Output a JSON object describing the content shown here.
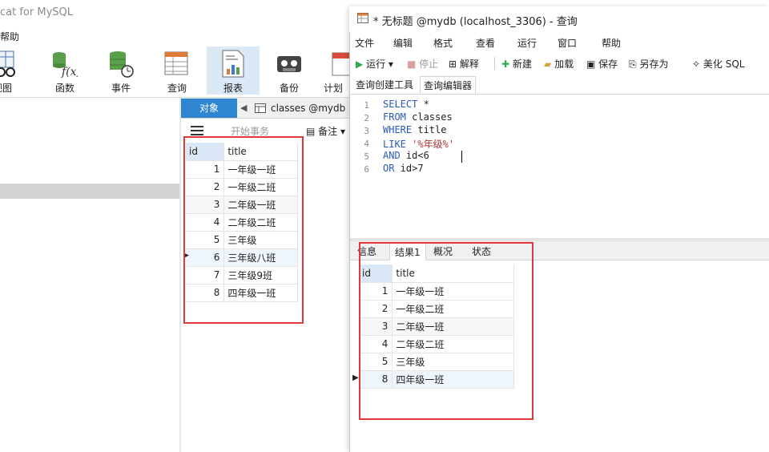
{
  "main_window": {
    "title": "cat for MySQL",
    "menu_help": "帮助",
    "toolbar": [
      {
        "label": "视图",
        "icon": "view-icon"
      },
      {
        "label": "函数",
        "icon": "function-icon"
      },
      {
        "label": "事件",
        "icon": "event-icon"
      },
      {
        "label": "查询",
        "icon": "query-icon"
      },
      {
        "label": "报表",
        "icon": "report-icon"
      },
      {
        "label": "备份",
        "icon": "backup-icon"
      },
      {
        "label": "计划",
        "icon": "schedule-icon"
      }
    ],
    "tabs": {
      "objects": "对象",
      "classes": "classes @mydb ("
    },
    "data_toolbar": {
      "begin_transaction": "开始事务",
      "note": "备注"
    },
    "grid": {
      "headers": [
        "id",
        "title"
      ],
      "rows": [
        {
          "id": "1",
          "title": "一年级一班"
        },
        {
          "id": "2",
          "title": "一年级二班"
        },
        {
          "id": "3",
          "title": "二年级一班"
        },
        {
          "id": "4",
          "title": "二年级二班"
        },
        {
          "id": "5",
          "title": "三年级"
        },
        {
          "id": "6",
          "title": "三年级八班"
        },
        {
          "id": "7",
          "title": "三年级9班"
        },
        {
          "id": "8",
          "title": "四年级一班"
        }
      ]
    }
  },
  "query_window": {
    "title": "* 无标题 @mydb (localhost_3306) - 查询",
    "menu": [
      "文件",
      "编辑",
      "格式",
      "查看",
      "运行",
      "窗口",
      "帮助"
    ],
    "toolbar": {
      "run": "运行",
      "stop": "停止",
      "explain": "解释",
      "new": "新建",
      "load": "加载",
      "save": "保存",
      "save_as": "另存为",
      "beautify": "美化 SQL"
    },
    "tabs": [
      "查询创建工具",
      "查询编辑器"
    ],
    "editor": {
      "line_numbers": [
        "1",
        "2",
        "3",
        "4",
        "5",
        "6"
      ],
      "lines": [
        {
          "kw": "SELECT",
          "rest": " *"
        },
        {
          "kw": "FROM",
          "rest": " classes"
        },
        {
          "kw": "WHERE",
          "rest": " title"
        },
        {
          "kw": "LIKE",
          "rest": " ",
          "str": "'%年级%'"
        },
        {
          "kw": "AND",
          "rest": " id<6"
        },
        {
          "kw": "OR",
          "rest": " id>7"
        }
      ]
    },
    "result_tabs": [
      "信息",
      "结果1",
      "概况",
      "状态"
    ],
    "results": {
      "headers": [
        "id",
        "title"
      ],
      "rows": [
        {
          "id": "1",
          "title": "一年级一班"
        },
        {
          "id": "2",
          "title": "一年级二班"
        },
        {
          "id": "3",
          "title": "二年级一班"
        },
        {
          "id": "4",
          "title": "二年级二班"
        },
        {
          "id": "5",
          "title": "三年级"
        },
        {
          "id": "8",
          "title": "四年级一班"
        }
      ]
    }
  },
  "colors": {
    "accent": "#2e86d1",
    "highlight_box": "#e0383c",
    "keyword": "#2a5ab8",
    "string": "#b33636"
  }
}
